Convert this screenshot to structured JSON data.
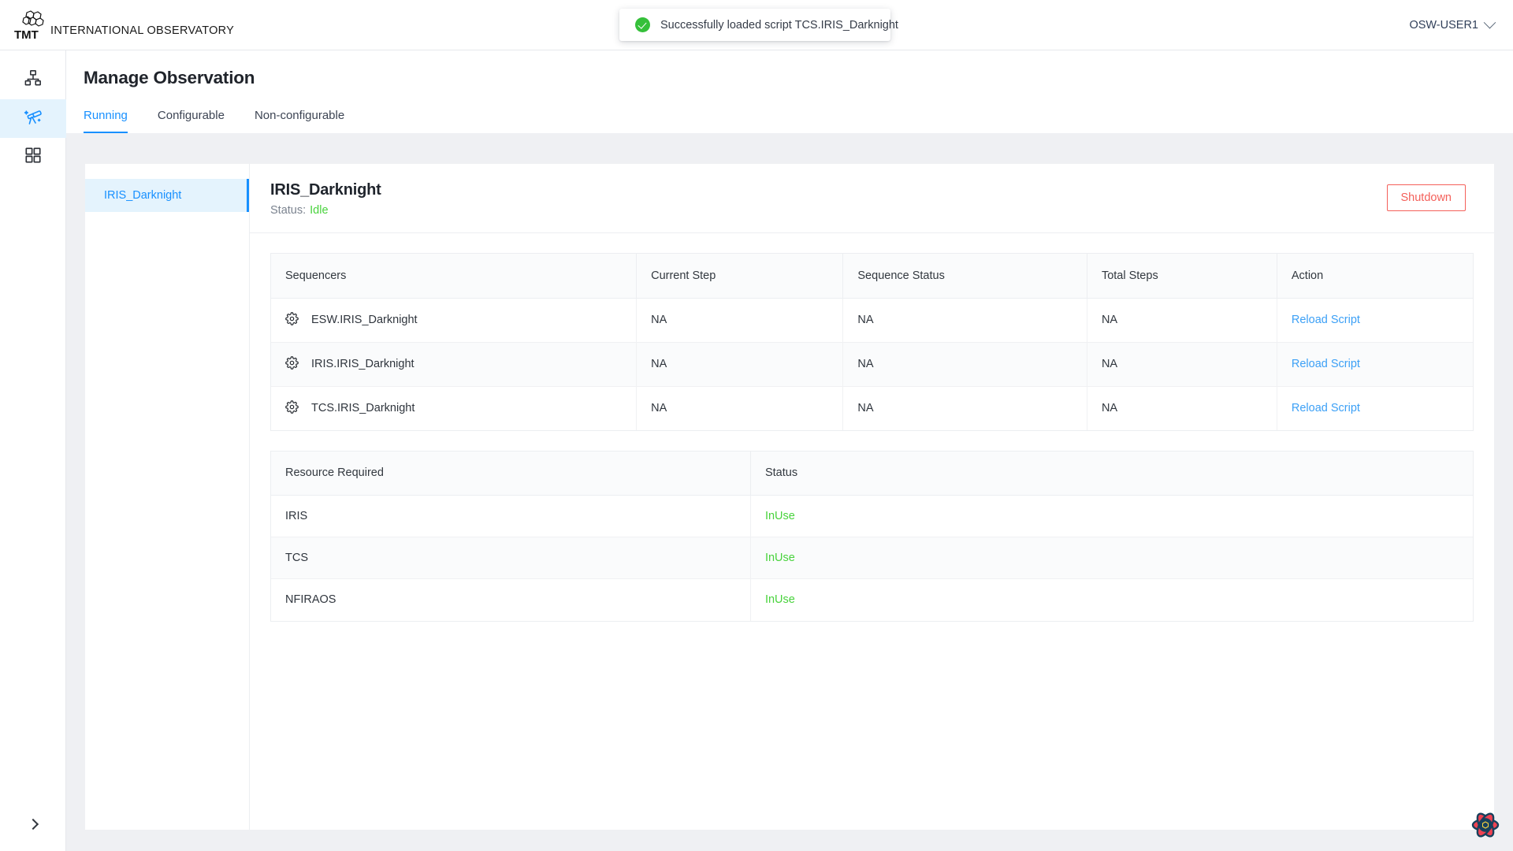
{
  "colors": {
    "accent": "#1890ff",
    "link": "#3ca0f6",
    "success": "#49d33d",
    "danger": "#f4605a",
    "page_bg": "#eff0f3",
    "selected_bg": "#e4f3fd"
  },
  "topbar": {
    "brand_tmt": "TMT",
    "brand_name": " INTERNATIONAL OBSERVATORY",
    "logo_icon": "tmt-mirror-segments-logo",
    "user": "OSW-USER1",
    "user_caret_icon": "chevron-down-icon"
  },
  "toast": {
    "icon": "success-check-circle-icon",
    "message": "Successfully loaded script TCS.IRIS_Darknight"
  },
  "rail": {
    "items": [
      {
        "icon": "sitemap-icon",
        "name": "resources",
        "active": false
      },
      {
        "icon": "telescope-icon",
        "name": "observation",
        "active": true
      },
      {
        "icon": "grid-dashboard-icon",
        "name": "dashboard",
        "active": false
      }
    ],
    "expand_icon": "chevron-right-icon"
  },
  "page": {
    "title": "Manage Observation",
    "tabs": [
      {
        "label": "Running",
        "active": true
      },
      {
        "label": "Configurable",
        "active": false
      },
      {
        "label": "Non-configurable",
        "active": false
      }
    ]
  },
  "obs_list": {
    "items": [
      {
        "label": "IRIS_Darknight",
        "selected": true
      }
    ]
  },
  "detail": {
    "title": "IRIS_Darknight",
    "status_label": "Status:",
    "status_value": "Idle",
    "shutdown_label": "Shutdown"
  },
  "sequencers_table": {
    "headers": [
      "Sequencers",
      "Current Step",
      "Sequence Status",
      "Total Steps",
      "Action"
    ],
    "rows": [
      {
        "icon": "gear-icon",
        "sequencer": "ESW.IRIS_Darknight",
        "current_step": "NA",
        "sequence_status": "NA",
        "total_steps": "NA",
        "action": "Reload Script"
      },
      {
        "icon": "gear-icon",
        "sequencer": "IRIS.IRIS_Darknight",
        "current_step": "NA",
        "sequence_status": "NA",
        "total_steps": "NA",
        "action": "Reload Script"
      },
      {
        "icon": "gear-icon",
        "sequencer": "TCS.IRIS_Darknight",
        "current_step": "NA",
        "sequence_status": "NA",
        "total_steps": "NA",
        "action": "Reload Script"
      }
    ]
  },
  "resources_table": {
    "headers": [
      "Resource Required",
      "Status"
    ],
    "rows": [
      {
        "resource": "IRIS",
        "status": "InUse"
      },
      {
        "resource": "TCS",
        "status": "InUse"
      },
      {
        "resource": "NFIRAOS",
        "status": "InUse"
      }
    ]
  },
  "devtools": {
    "icon": "react-query-devtools-logo"
  }
}
